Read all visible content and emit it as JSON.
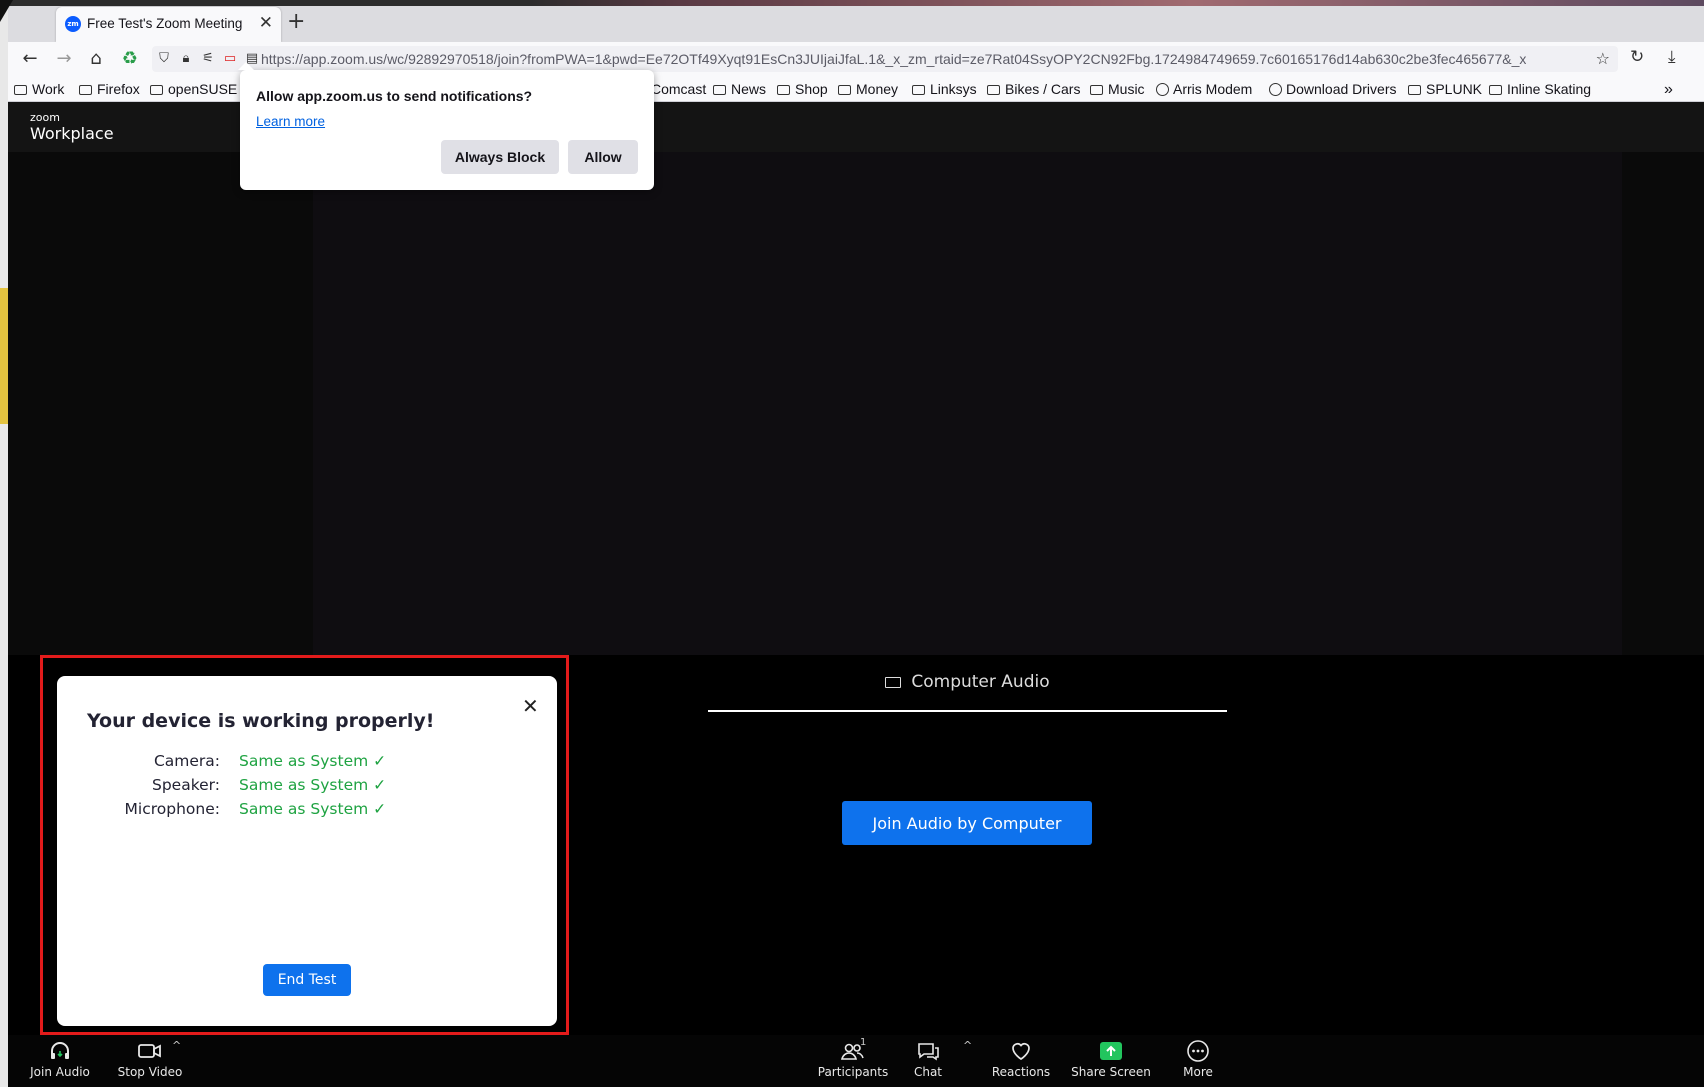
{
  "browser": {
    "tab_title": "Free Test's Zoom Meeting",
    "favicon_text": "zm",
    "url": "https://app.zoom.us/wc/92892970518/join?fromPWA=1&pwd=Ee72OTf49Xyqt91EsCn3JUIjaiJfaL.1&_x_zm_rtaid=ze7Rat04SsyOPY2CN92Fbg.1724984749659.7c60165176d14ab630c2be3fec465677&_x_",
    "bookmarks": [
      "Work",
      "Firefox",
      "openSUSE",
      "Comcast",
      "News",
      "Shop",
      "Money",
      "Linksys",
      "Bikes / Cars",
      "Music",
      "Arris Modem",
      "Download Drivers",
      "SPLUNK",
      "Inline Skating"
    ]
  },
  "notification": {
    "question": "Allow app.zoom.us to send notifications?",
    "learn_more": "Learn more",
    "block_label": "Always Block",
    "allow_label": "Allow"
  },
  "zoom": {
    "logo_small": "zoom",
    "logo_large": "Workplace"
  },
  "device_test": {
    "title": "Your device is working properly!",
    "rows": [
      {
        "label": "Camera:",
        "value": "Same as System ✓"
      },
      {
        "label": "Speaker:",
        "value": "Same as System ✓"
      },
      {
        "label": "Microphone:",
        "value": "Same as System ✓"
      }
    ],
    "end_test_label": "End Test"
  },
  "audio_panel": {
    "tab_label": "Computer Audio",
    "join_button": "Join Audio by Computer"
  },
  "toolbar": {
    "join_audio": "Join Audio",
    "stop_video": "Stop Video",
    "participants": "Participants",
    "participants_count": "1",
    "chat": "Chat",
    "reactions": "Reactions",
    "share_screen": "Share Screen",
    "more": "More",
    "share_color": "#22c55e"
  }
}
